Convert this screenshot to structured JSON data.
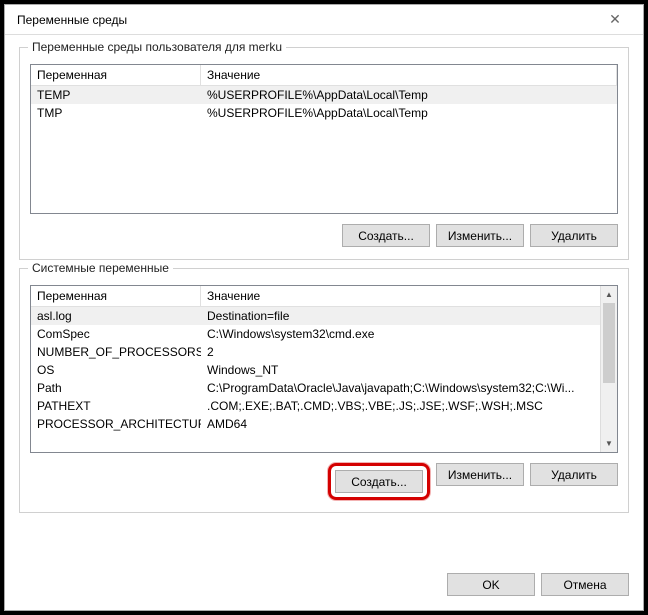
{
  "title": "Переменные среды",
  "user_group": {
    "label": "Переменные среды пользователя для merku",
    "header_var": "Переменная",
    "header_val": "Значение",
    "rows": [
      {
        "name": "TEMP",
        "value": "%USERPROFILE%\\AppData\\Local\\Temp"
      },
      {
        "name": "TMP",
        "value": "%USERPROFILE%\\AppData\\Local\\Temp"
      }
    ]
  },
  "system_group": {
    "label": "Системные переменные",
    "header_var": "Переменная",
    "header_val": "Значение",
    "rows": [
      {
        "name": "asl.log",
        "value": "Destination=file"
      },
      {
        "name": "ComSpec",
        "value": "C:\\Windows\\system32\\cmd.exe"
      },
      {
        "name": "NUMBER_OF_PROCESSORS",
        "value": "2"
      },
      {
        "name": "OS",
        "value": "Windows_NT"
      },
      {
        "name": "Path",
        "value": "C:\\ProgramData\\Oracle\\Java\\javapath;C:\\Windows\\system32;C:\\Wi..."
      },
      {
        "name": "PATHEXT",
        "value": ".COM;.EXE;.BAT;.CMD;.VBS;.VBE;.JS;.JSE;.WSF;.WSH;.MSC"
      },
      {
        "name": "PROCESSOR_ARCHITECTURE",
        "value": "AMD64"
      }
    ]
  },
  "buttons": {
    "create": "Создать...",
    "edit": "Изменить...",
    "delete": "Удалить",
    "ok": "OK",
    "cancel": "Отмена"
  }
}
